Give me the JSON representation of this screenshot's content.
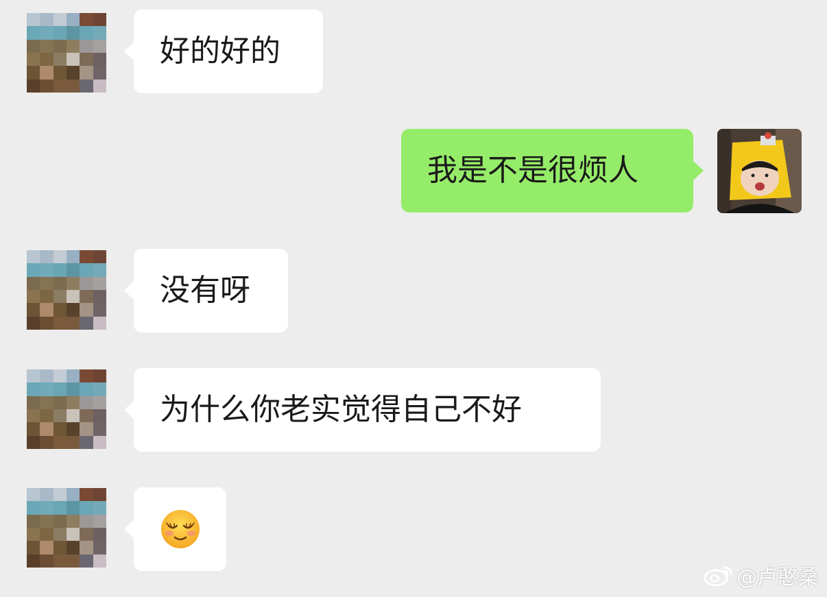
{
  "messages": [
    {
      "side": "left",
      "text": "好的好的"
    },
    {
      "side": "right",
      "text": "我是不是很烦人"
    },
    {
      "side": "left",
      "text": "没有呀"
    },
    {
      "side": "left",
      "text": "为什么你老实觉得自己不好"
    },
    {
      "side": "left",
      "text": "",
      "emoji": "smiling-blush-emoji"
    }
  ],
  "colors": {
    "background": "#ededed",
    "received_bubble": "#ffffff",
    "sent_bubble": "#95ec69",
    "text": "#1a1a1a"
  },
  "icons": {
    "contact_avatar": "pixelated-avatar",
    "user_avatar": "photo-avatar-yellow-hat",
    "watermark_logo": "weibo-icon"
  },
  "watermark": {
    "text": "@卢憨桑"
  }
}
